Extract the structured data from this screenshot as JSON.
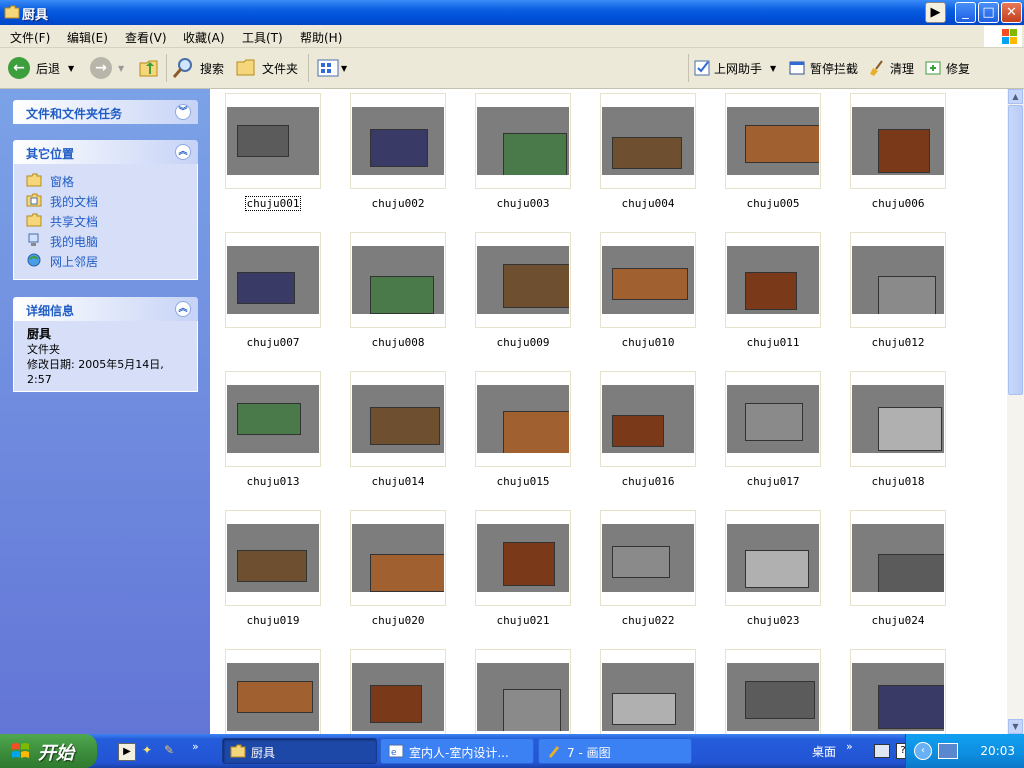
{
  "window": {
    "title": "厨具",
    "buttons": {
      "minimize": "_",
      "maximize": "□",
      "close": "✕"
    }
  },
  "menu": [
    "文件(F)",
    "编辑(E)",
    "查看(V)",
    "收藏(A)",
    "工具(T)",
    "帮助(H)"
  ],
  "toolbar": {
    "back": "后退",
    "search": "搜索",
    "folders": "文件夹",
    "online_helper": "上网助手",
    "popup_block": "暂停拦截",
    "clean": "清理",
    "repair": "修复"
  },
  "sidebar": {
    "tasks_title": "文件和文件夹任务",
    "places_title": "其它位置",
    "places": [
      "窗格",
      "我的文档",
      "共享文档",
      "我的电脑",
      "网上邻居"
    ],
    "details_title": "详细信息",
    "details": {
      "name": "厨具",
      "type": "文件夹",
      "modified": "修改日期: 2005年5月14日, 2:57"
    }
  },
  "files": [
    "chuju001",
    "chuju002",
    "chuju003",
    "chuju004",
    "chuju005",
    "chuju006",
    "chuju007",
    "chuju008",
    "chuju009",
    "chuju010",
    "chuju011",
    "chuju012",
    "chuju013",
    "chuju014",
    "chuju015",
    "chuju016",
    "chuju017",
    "chuju018",
    "chuju019",
    "chuju020",
    "chuju021",
    "chuju022",
    "chuju023",
    "chuju024"
  ],
  "selected_file": "chuju001",
  "taskbar": {
    "start": "开始",
    "tasks": [
      "厨具",
      "室内人-室内设计...",
      "7 - 画图"
    ],
    "desktop": "桌面",
    "clock": "20:03"
  },
  "colors": {
    "titlebar": "#0a5ee0",
    "sidebar": "#6375d6",
    "panel_link": "#215dc6",
    "taskbar": "#2254d4",
    "start": "#3a8a3a"
  }
}
